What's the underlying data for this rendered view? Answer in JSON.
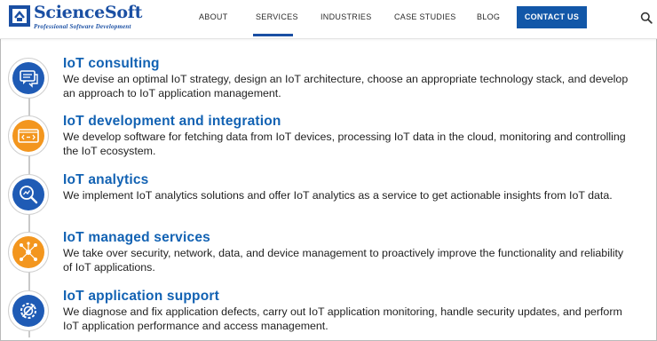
{
  "brand": {
    "name": "ScienceSoft",
    "tagline": "Professional Software Development",
    "color": "#1a4fa3"
  },
  "nav": {
    "items": [
      {
        "label": "ABOUT"
      },
      {
        "label": "SERVICES",
        "active": true
      },
      {
        "label": "INDUSTRIES"
      },
      {
        "label": "CASE STUDIES"
      },
      {
        "label": "BLOG"
      }
    ],
    "contact_label": "CONTACT US",
    "search_icon": "search-icon"
  },
  "services": [
    {
      "title": "IoT consulting",
      "description": "We devise an optimal IoT strategy, design an IoT architecture, choose an appropriate technology stack, and develop an approach to IoT application management.",
      "icon": "chat-bubbles-icon",
      "color": "#1f5bb5"
    },
    {
      "title": "IoT development and integration",
      "description": "We develop software for fetching data from IoT devices, processing IoT data in the cloud, monitoring and controlling the IoT ecosystem.",
      "icon": "code-window-icon",
      "color": "#f3961e"
    },
    {
      "title": "IoT analytics",
      "description": "We implement IoT analytics solutions and offer IoT analytics as a service to get actionable insights from IoT data.",
      "icon": "magnifier-chart-icon",
      "color": "#1f5bb5"
    },
    {
      "title": "IoT managed services",
      "description": "We take over security, network, data, and device management to proactively improve the functionality and reliability of IoT applications.",
      "icon": "network-nodes-icon",
      "color": "#f3961e"
    },
    {
      "title": "IoT application support",
      "description": "We diagnose and fix application defects, carry out IoT application monitoring, handle security updates, and perform IoT application performance and access management.",
      "icon": "gear-wrench-icon",
      "color": "#1f5bb5"
    }
  ]
}
